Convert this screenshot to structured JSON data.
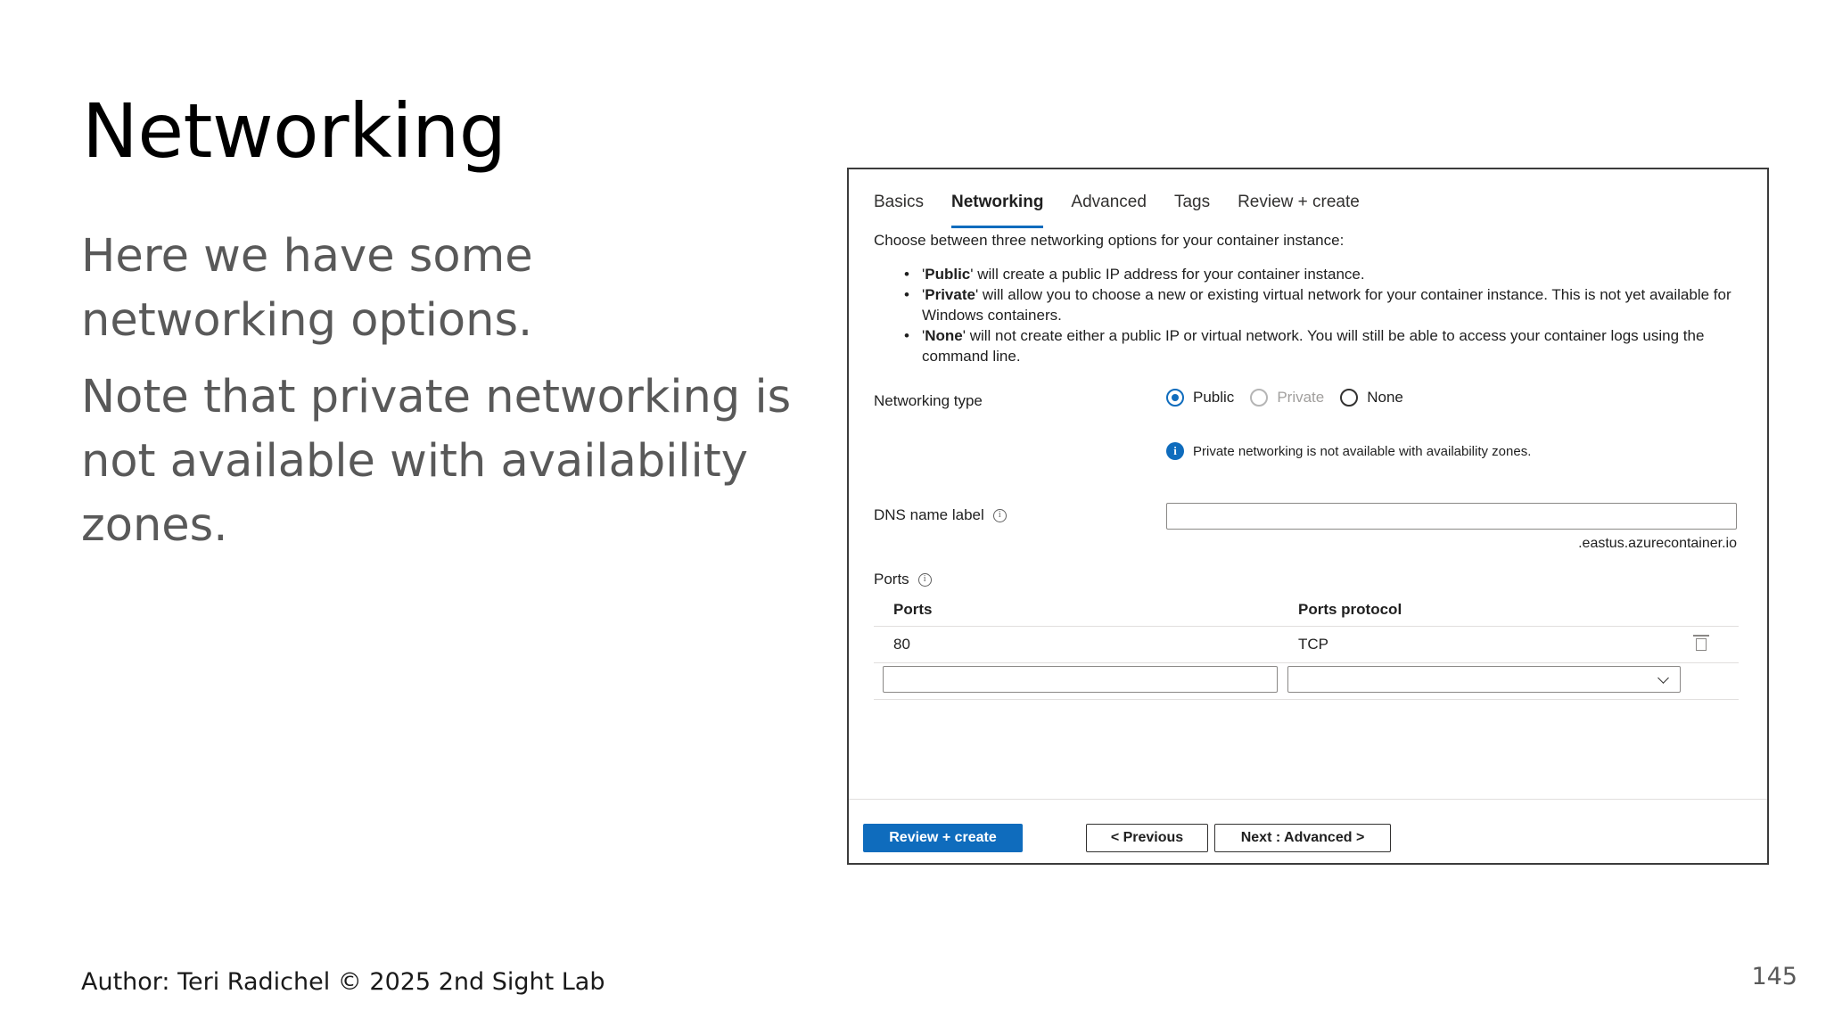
{
  "slide": {
    "title": "Networking",
    "paragraphs": [
      "Here we have some networking options.",
      "Note that private networking is not available with availability zones."
    ],
    "footer": "Author: Teri Radichel © 2025 2nd Sight Lab",
    "page_number": "145"
  },
  "screenshot": {
    "tabs": [
      "Basics",
      "Networking",
      "Advanced",
      "Tags",
      "Review + create"
    ],
    "active_tab": "Networking",
    "intro": "Choose between three networking options for your container instance:",
    "bullets": [
      {
        "term": "Public",
        "text": " will create a public IP address for your container instance."
      },
      {
        "term": "Private",
        "text": " will allow you to choose a new or existing virtual network for your container instance. This is not yet available for Windows containers."
      },
      {
        "term": "None",
        "text": " will not create either a public IP or virtual network. You will still be able to access your container logs using the command line."
      }
    ],
    "networking_type": {
      "label": "Networking type",
      "options": [
        {
          "label": "Public",
          "checked": true,
          "disabled": false
        },
        {
          "label": "Private",
          "checked": false,
          "disabled": true
        },
        {
          "label": "None",
          "checked": false,
          "disabled": false
        }
      ],
      "notice": "Private networking is not available with availability zones."
    },
    "dns": {
      "label": "DNS name label",
      "value": "",
      "suffix": ".eastus.azurecontainer.io"
    },
    "ports": {
      "label": "Ports",
      "headers": [
        "Ports",
        "Ports protocol"
      ],
      "rows": [
        {
          "port": "80",
          "protocol": "TCP"
        }
      ],
      "new_port_value": "",
      "new_protocol_value": ""
    },
    "buttons": {
      "review_create": "Review + create",
      "previous": "< Previous",
      "next": "Next : Advanced >"
    },
    "colors": {
      "accent": "#0f6cbd",
      "body_text_gray": "#595959"
    }
  }
}
